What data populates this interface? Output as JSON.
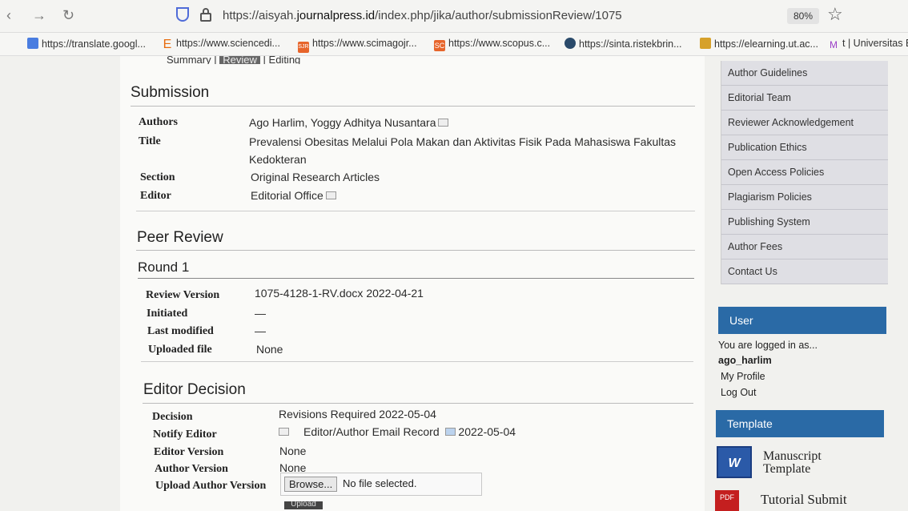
{
  "browser": {
    "url_prefix": "https://aisyah.",
    "url_domain": "journalpress.id",
    "url_path": "/index.php/jika/author/submissionReview/1075",
    "zoom": "80%",
    "bookmarks": [
      "https://translate.googl...",
      "https://www.sciencedi...",
      "https://www.scimagojr...",
      "https://www.scopus.c...",
      "https://sinta.ristekbrin...",
      "https://elearning.ut.ac...",
      "t | Universitas B"
    ],
    "bookmark_icons": [
      "",
      "E",
      "SJR",
      "SC",
      "",
      "",
      "M"
    ]
  },
  "tabs": {
    "summary": "Summary",
    "review": "Review",
    "editing": "Editing",
    "sep": "|"
  },
  "submission": {
    "heading": "Submission",
    "authors_label": "Authors",
    "authors": "Ago Harlim, Yoggy Adhitya Nusantara",
    "title_label": "Title",
    "title_line1": "Prevalensi Obesitas Melalui Pola Makan dan Aktivitas Fisik Pada Mahasiswa Fakultas",
    "title_line2": "Kedokteran",
    "section_label": "Section",
    "section": "Original Research Articles",
    "editor_label": "Editor",
    "editor": "Editorial Office"
  },
  "peer_review": {
    "heading": "Peer Review",
    "round": "Round 1",
    "review_version_label": "Review Version",
    "review_version": "1075-4128-1-RV.docx  2022-04-21",
    "initiated_label": "Initiated",
    "initiated": "—",
    "last_modified_label": "Last modified",
    "last_modified": "—",
    "uploaded_file_label": "Uploaded file",
    "uploaded_file": "None"
  },
  "editor_decision": {
    "heading": "Editor Decision",
    "decision_label": "Decision",
    "decision": "Revisions Required 2022-05-04",
    "notify_label": "Notify Editor",
    "notify": "Editor/Author Email Record",
    "notify_date": "2022-05-04",
    "editor_version_label": "Editor Version",
    "editor_version": "None",
    "author_version_label": "Author Version",
    "author_version": "None",
    "upload_label": "Upload Author Version",
    "browse": "Browse...",
    "no_file": "No file selected.",
    "upload_btn": "Upload"
  },
  "sidebar": {
    "menu": [
      "Author Guidelines",
      "Editorial Team",
      "Reviewer Acknowledgement",
      "Publication Ethics",
      "Open Access Policies",
      "Plagiarism Policies",
      "Publishing System",
      "Author Fees",
      "Contact Us"
    ],
    "user_heading": "User",
    "logged_in_as": "You are logged in as...",
    "username": "ago_harlim",
    "my_profile": "My Profile",
    "log_out": "Log Out",
    "template_heading": "Template",
    "manuscript_line1": "Manuscript",
    "manuscript_line2": "Template",
    "tutorial": "Tutorial Submit"
  }
}
